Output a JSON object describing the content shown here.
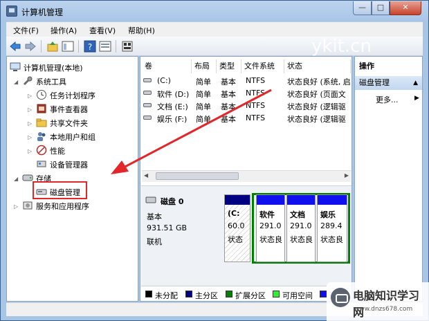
{
  "window": {
    "title": "计算机管理"
  },
  "menu": [
    "文件(F)",
    "操作(A)",
    "查看(V)",
    "帮助(H)"
  ],
  "tree": {
    "root": "计算机管理(本地)",
    "system_tools": "系统工具",
    "system_children": [
      "任务计划程序",
      "事件查看器",
      "共享文件夹",
      "本地用户和组",
      "性能",
      "设备管理器"
    ],
    "storage": "存储",
    "disk_mgmt": "磁盘管理",
    "services": "服务和应用程序"
  },
  "columns": [
    "卷",
    "布局",
    "类型",
    "文件系统",
    "状态"
  ],
  "volumes": [
    {
      "name": "(C:)",
      "layout": "简单",
      "type": "基本",
      "fs": "NTFS",
      "status": "状态良好 (系统, 启"
    },
    {
      "name": "软件 (D:)",
      "layout": "简单",
      "type": "基本",
      "fs": "NTFS",
      "status": "状态良好 (页面文"
    },
    {
      "name": "文档 (E:)",
      "layout": "简单",
      "type": "基本",
      "fs": "NTFS",
      "status": "状态良好 (逻辑驱"
    },
    {
      "name": "娱乐 (F:)",
      "layout": "简单",
      "type": "基本",
      "fs": "NTFS",
      "status": "状态良好 (逻辑驱"
    }
  ],
  "disk": {
    "name": "磁盘 0",
    "kind": "基本",
    "size": "931.51 GB",
    "state": "联机"
  },
  "partitions": [
    {
      "label": "(C:",
      "size": "60.0",
      "status": "状态"
    },
    {
      "label": "软件",
      "size": "291.0",
      "status": "状态良"
    },
    {
      "label": "文档",
      "size": "291.0",
      "status": "状态良"
    },
    {
      "label": "娱乐",
      "size": "289.4",
      "status": "状态良"
    }
  ],
  "legend": [
    {
      "label": "未分配",
      "color": "#000000"
    },
    {
      "label": "主分区",
      "color": "#000080"
    },
    {
      "label": "扩展分区",
      "color": "#008000"
    },
    {
      "label": "可用空间",
      "color": "#33ee33"
    },
    {
      "label": "逻辑",
      "color": "#1010ee"
    }
  ],
  "actions": {
    "header": "操作",
    "section": "磁盘管理",
    "more": "更多..."
  },
  "watermarks": {
    "site": "ykit.cn",
    "brand": "电脑知识学习网",
    "url": "www.dnzs678.com"
  },
  "colors": {
    "highlight": "#e2262a",
    "primary": "#000080",
    "extended": "#008000"
  }
}
